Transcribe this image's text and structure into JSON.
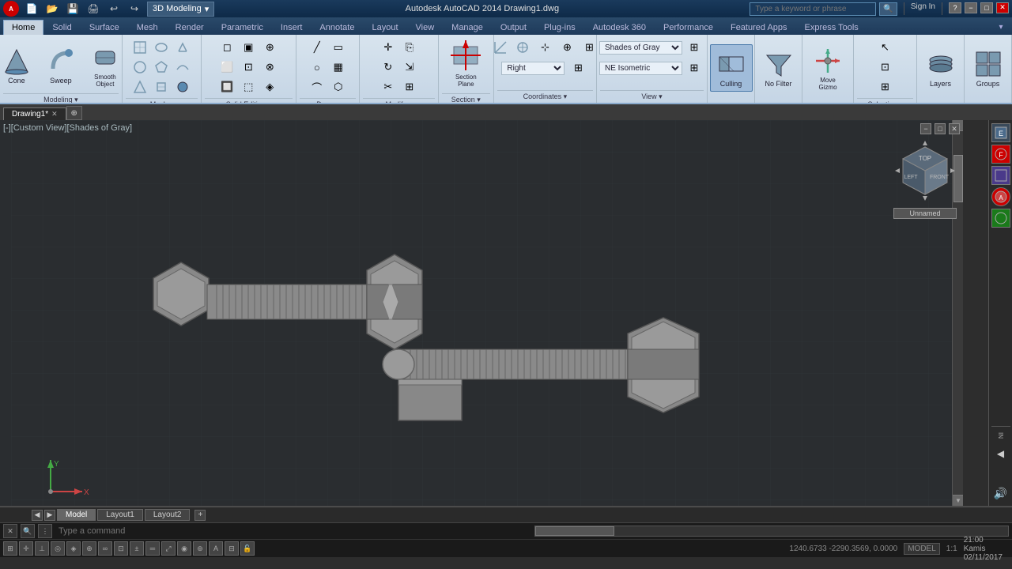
{
  "titlebar": {
    "logo": "A",
    "workspace": "3D Modeling",
    "title": "Autodesk AutoCAD 2014  Drawing1.dwg",
    "search_placeholder": "Type a keyword or phrase",
    "signin": "Sign In",
    "min": "−",
    "max": "□",
    "close": "✕"
  },
  "ribbon_tabs": [
    {
      "label": "Home",
      "active": true
    },
    {
      "label": "Solid"
    },
    {
      "label": "Surface"
    },
    {
      "label": "Mesh"
    },
    {
      "label": "Render"
    },
    {
      "label": "Parametric"
    },
    {
      "label": "Insert"
    },
    {
      "label": "Annotate"
    },
    {
      "label": "Layout"
    },
    {
      "label": "View"
    },
    {
      "label": "Manage"
    },
    {
      "label": "Output"
    },
    {
      "label": "Plug-ins"
    },
    {
      "label": "Autodesk 360"
    },
    {
      "label": "Performance"
    },
    {
      "label": "Featured Apps"
    },
    {
      "label": "Express Tools"
    }
  ],
  "panels": {
    "modeling": {
      "label": "Modeling",
      "buttons": [
        {
          "icon": "⬡",
          "label": "Cone"
        },
        {
          "icon": "🔄",
          "label": "Sweep"
        },
        {
          "icon": "◻",
          "label": "Smooth Object"
        }
      ]
    },
    "mesh": {
      "label": "Mesh"
    },
    "solid_editing": {
      "label": "Solid Editing"
    },
    "draw": {
      "label": "Draw"
    },
    "modify": {
      "label": "Modify"
    },
    "section": {
      "label": "Section",
      "buttons": [
        {
          "icon": "✂",
          "label": "Section Plane"
        }
      ]
    },
    "coordinates": {
      "label": "Coordinates"
    },
    "view_panel": {
      "label": "View",
      "view_label": "Right",
      "shading": "Shades of Gray",
      "ne_iso": "NE Isometric"
    },
    "selection": {
      "label": "Selection"
    },
    "culling": {
      "label": "Culling",
      "active": true
    },
    "no_filter": {
      "label": "No Filter"
    },
    "move_gizmo": {
      "label": "Move Gizmo"
    },
    "layers": {
      "label": "Layers"
    },
    "groups": {
      "label": "Groups"
    }
  },
  "viewport": {
    "label": "[-][Custom View][Shades of Gray]",
    "viewcube_label": "Unnamed"
  },
  "sub_panels": [
    {
      "label": "Modeling",
      "has_arrow": true
    },
    {
      "label": "Mesh",
      "has_arrow": true
    },
    {
      "label": "Solid Editing",
      "has_arrow": true
    },
    {
      "label": "Draw",
      "has_arrow": true
    },
    {
      "label": "Modify",
      "has_arrow": true
    },
    {
      "label": "Section",
      "has_arrow": true
    },
    {
      "label": "Coordinates",
      "has_arrow": true
    },
    {
      "label": "View",
      "has_arrow": true
    },
    {
      "label": "Selection",
      "has_arrow": true
    }
  ],
  "doc_tabs": [
    {
      "label": "Drawing1*",
      "active": true
    }
  ],
  "layout_tabs": [
    {
      "label": "Model",
      "active": true
    },
    {
      "label": "Layout1"
    },
    {
      "label": "Layout2"
    }
  ],
  "statusbar": {
    "coords": "1240.6733  -2290.3569, 0.0000",
    "model": "MODEL",
    "scale": "1:1",
    "time": "21:00",
    "day": "Kamis",
    "date": "02/11/2017"
  },
  "cmdline": {
    "placeholder": "Type a command"
  }
}
